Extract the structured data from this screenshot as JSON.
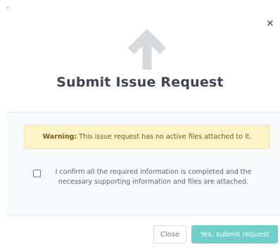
{
  "modal": {
    "close_glyph": "×",
    "icon": "arrow-up-icon",
    "title": "Submit Issue Request"
  },
  "warning": {
    "label": "Warning:",
    "message": "This issue request has no active files attached to it."
  },
  "confirm": {
    "checked": false,
    "text": "I confirm all the required information is completed and the necessary supporting information and files are attached."
  },
  "footer": {
    "close_label": "Close",
    "submit_label": "Yes, submit request"
  },
  "colors": {
    "arrow": "#d7d9dc",
    "title": "#3f4450",
    "warning_bg": "#fdf2c8",
    "submit_bg": "#6fcfc8"
  }
}
